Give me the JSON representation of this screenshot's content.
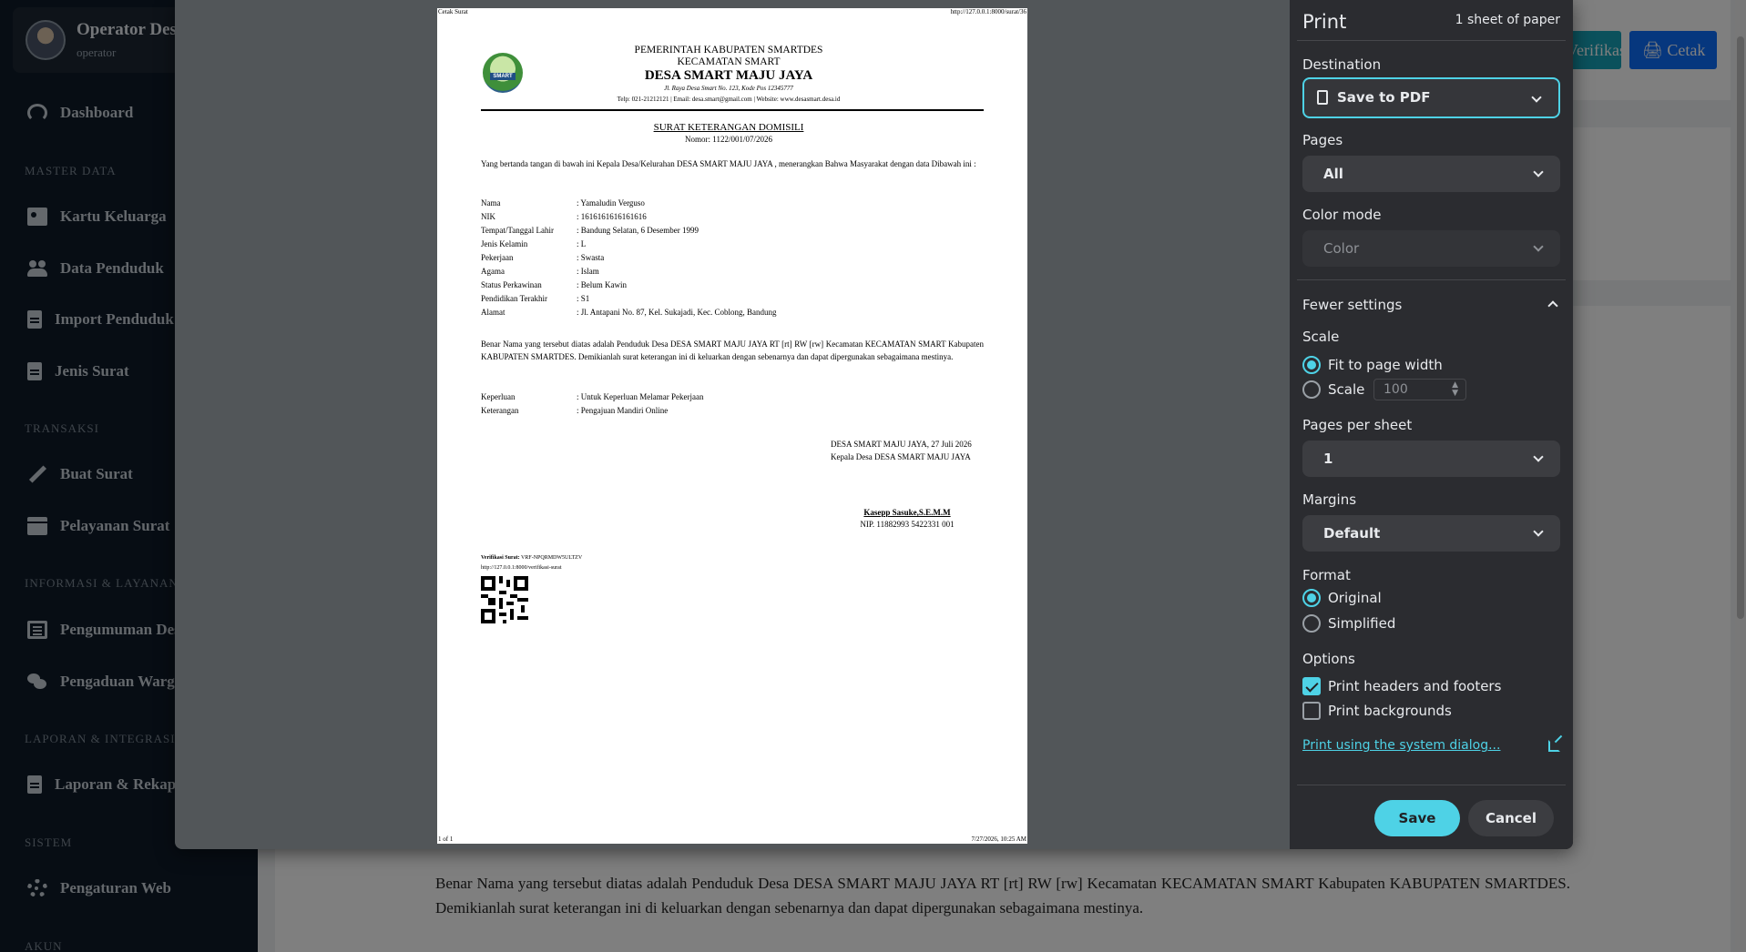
{
  "app": {
    "user_name": "Operator Desa",
    "user_role": "operator",
    "nav": {
      "dashboard": "Dashboard",
      "section_master": "MASTER DATA",
      "kartu_keluarga": "Kartu Keluarga",
      "data_penduduk": "Data Penduduk",
      "import_penduduk": "Import Penduduk",
      "jenis_surat": "Jenis Surat",
      "section_transaksi": "TRANSAKSI",
      "buat_surat": "Buat Surat",
      "pelayanan_surat": "Pelayanan Surat",
      "section_informasi": "INFORMASI & LAYANAN",
      "pengumuman": "Pengumuman Desa",
      "pengaduan": "Pengaduan Warga",
      "section_laporan": "LAPORAN & INTEGRASI",
      "laporan": "Laporan & Rekap",
      "section_sistem": "SISTEM",
      "pengaturan": "Pengaturan Web",
      "section_akun": "AKUN"
    },
    "buttons": {
      "verifikasi": "Verifikasi",
      "cetak": "Cetak"
    },
    "background_paragraph": "Benar Nama yang tersebut diatas adalah Penduduk Desa DESA SMART MAJU JAYA RT [rt] RW [rw] Kecamatan KECAMATAN SMART Kabupaten KABUPATEN SMARTDES. Demikianlah surat keterangan ini di keluarkan dengan sebenarnya dan dapat dipergunakan sebagaimana mestinya."
  },
  "preview": {
    "header_left": "Cetak Surat",
    "header_right": "http://127.0.0.1:8000/surat/36",
    "footer_left": "1 of 1",
    "footer_right": "7/27/2026, 10:25 AM",
    "logo_text": "SMART",
    "kop_line1": "PEMERINTAH KABUPATEN SMARTDES",
    "kop_line2": "KECAMATAN SMART",
    "kop_line3": "DESA SMART MAJU JAYA",
    "kop_address": "Jl. Raya Desa Smart No. 123, Kode Pos 12345777",
    "kop_contact": "Telp: 021-21212121 | Email: desa.smart@gmail.com | Website: www.desasmart.desa.id",
    "letter_title": "SURAT KETERANGAN DOMISILI",
    "letter_number": "Nomor: 1122/001/07/2026",
    "intro": "Yang bertanda tangan di bawah ini Kepala Desa/Kelurahan DESA SMART MAJU JAYA , menerangkan Bahwa Masyarakat dengan data Dibawah ini :",
    "fields": [
      {
        "label": "Nama",
        "value": ": Yamaludin Verguso"
      },
      {
        "label": "NIK",
        "value": ": 1616161616161616"
      },
      {
        "label": "Tempat/Tanggal Lahir",
        "value": ": Bandung Selatan, 6 Desember 1999"
      },
      {
        "label": "Jenis Kelamin",
        "value": ": L"
      },
      {
        "label": "Pekerjaan",
        "value": ": Swasta"
      },
      {
        "label": "Agama",
        "value": ": Islam"
      },
      {
        "label": "Status Perkawinan",
        "value": ": Belum Kawin"
      },
      {
        "label": "Pendidikan Terakhir",
        "value": ": S1"
      },
      {
        "label": "Alamat",
        "value": ": Jl. Antapani No. 87, Kel. Sukajadi, Kec. Coblong, Bandung"
      }
    ],
    "body": "Benar Nama yang tersebut diatas adalah Penduduk Desa DESA SMART MAJU JAYA RT [rt] RW [rw] Kecamatan KECAMATAN SMART Kabupaten KABUPATEN SMARTDES. Demikianlah surat keterangan ini di keluarkan dengan sebenarnya dan dapat dipergunakan sebagaimana mestinya.",
    "keperluan_label": "Keperluan",
    "keperluan_value": ": Untuk Keperluan Melamar Pekerjaan",
    "keterangan_label": "Keterangan",
    "keterangan_value": ": Pengajuan Mandiri Online",
    "sign_place_date": "DESA SMART MAJU JAYA, 27 Juli 2026",
    "sign_role": "Kepala Desa DESA SMART MAJU JAYA",
    "sign_name": "Kasepp Sasuke,S.E.M.M",
    "sign_nip": "NIP. 11882993 5422331 001",
    "verif_label": "Verifikasi Surat:",
    "verif_code": "VRF-NPQRMDW5ULTZV",
    "verif_url": "http://127.0.0.1:8000/verifikasi-surat"
  },
  "print_settings": {
    "title": "Print",
    "sheet_count": "1 sheet of paper",
    "destination_label": "Destination",
    "destination_value": "Save to PDF",
    "pages_label": "Pages",
    "pages_value": "All",
    "color_label": "Color mode",
    "color_value": "Color",
    "fewer_settings": "Fewer settings",
    "scale_label": "Scale",
    "scale_fit": "Fit to page width",
    "scale_custom": "Scale",
    "scale_value": "100",
    "pps_label": "Pages per sheet",
    "pps_value": "1",
    "margins_label": "Margins",
    "margins_value": "Default",
    "format_label": "Format",
    "format_original": "Original",
    "format_simplified": "Simplified",
    "options_label": "Options",
    "opt_headers": "Print headers and footers",
    "opt_backgrounds": "Print backgrounds",
    "system_dialog": "Print using the system dialog...",
    "save": "Save",
    "cancel": "Cancel"
  },
  "colors": {
    "accent": "#4ed2e6",
    "dialog_bg": "#2b2c30",
    "sidebar_bg": "#0f1b29"
  }
}
